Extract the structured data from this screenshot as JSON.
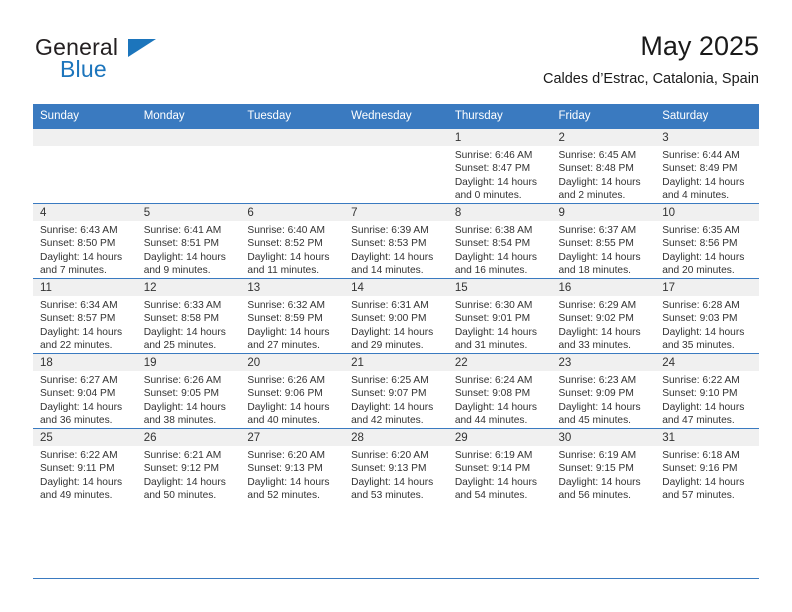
{
  "brand": {
    "name_top": "General",
    "name_bottom": "Blue",
    "accent_color": "#1c75bc"
  },
  "header": {
    "title": "May 2025",
    "subtitle": "Caldes d’Estrac, Catalonia, Spain"
  },
  "theme": {
    "header_bg": "#3a7ac0",
    "daynum_bg": "#f0f0f0",
    "grid_line": "#3a7ac0",
    "text": "#333333"
  },
  "weekday_headers": [
    "Sunday",
    "Monday",
    "Tuesday",
    "Wednesday",
    "Thursday",
    "Friday",
    "Saturday"
  ],
  "weeks": [
    [
      {
        "day": "",
        "empty": true
      },
      {
        "day": "",
        "empty": true
      },
      {
        "day": "",
        "empty": true
      },
      {
        "day": "",
        "empty": true
      },
      {
        "day": "1",
        "sunrise": "Sunrise: 6:46 AM",
        "sunset": "Sunset: 8:47 PM",
        "daylight_line1": "Daylight: 14 hours",
        "daylight_line2": "and 0 minutes."
      },
      {
        "day": "2",
        "sunrise": "Sunrise: 6:45 AM",
        "sunset": "Sunset: 8:48 PM",
        "daylight_line1": "Daylight: 14 hours",
        "daylight_line2": "and 2 minutes."
      },
      {
        "day": "3",
        "sunrise": "Sunrise: 6:44 AM",
        "sunset": "Sunset: 8:49 PM",
        "daylight_line1": "Daylight: 14 hours",
        "daylight_line2": "and 4 minutes."
      }
    ],
    [
      {
        "day": "4",
        "sunrise": "Sunrise: 6:43 AM",
        "sunset": "Sunset: 8:50 PM",
        "daylight_line1": "Daylight: 14 hours",
        "daylight_line2": "and 7 minutes."
      },
      {
        "day": "5",
        "sunrise": "Sunrise: 6:41 AM",
        "sunset": "Sunset: 8:51 PM",
        "daylight_line1": "Daylight: 14 hours",
        "daylight_line2": "and 9 minutes."
      },
      {
        "day": "6",
        "sunrise": "Sunrise: 6:40 AM",
        "sunset": "Sunset: 8:52 PM",
        "daylight_line1": "Daylight: 14 hours",
        "daylight_line2": "and 11 minutes."
      },
      {
        "day": "7",
        "sunrise": "Sunrise: 6:39 AM",
        "sunset": "Sunset: 8:53 PM",
        "daylight_line1": "Daylight: 14 hours",
        "daylight_line2": "and 14 minutes."
      },
      {
        "day": "8",
        "sunrise": "Sunrise: 6:38 AM",
        "sunset": "Sunset: 8:54 PM",
        "daylight_line1": "Daylight: 14 hours",
        "daylight_line2": "and 16 minutes."
      },
      {
        "day": "9",
        "sunrise": "Sunrise: 6:37 AM",
        "sunset": "Sunset: 8:55 PM",
        "daylight_line1": "Daylight: 14 hours",
        "daylight_line2": "and 18 minutes."
      },
      {
        "day": "10",
        "sunrise": "Sunrise: 6:35 AM",
        "sunset": "Sunset: 8:56 PM",
        "daylight_line1": "Daylight: 14 hours",
        "daylight_line2": "and 20 minutes."
      }
    ],
    [
      {
        "day": "11",
        "sunrise": "Sunrise: 6:34 AM",
        "sunset": "Sunset: 8:57 PM",
        "daylight_line1": "Daylight: 14 hours",
        "daylight_line2": "and 22 minutes."
      },
      {
        "day": "12",
        "sunrise": "Sunrise: 6:33 AM",
        "sunset": "Sunset: 8:58 PM",
        "daylight_line1": "Daylight: 14 hours",
        "daylight_line2": "and 25 minutes."
      },
      {
        "day": "13",
        "sunrise": "Sunrise: 6:32 AM",
        "sunset": "Sunset: 8:59 PM",
        "daylight_line1": "Daylight: 14 hours",
        "daylight_line2": "and 27 minutes."
      },
      {
        "day": "14",
        "sunrise": "Sunrise: 6:31 AM",
        "sunset": "Sunset: 9:00 PM",
        "daylight_line1": "Daylight: 14 hours",
        "daylight_line2": "and 29 minutes."
      },
      {
        "day": "15",
        "sunrise": "Sunrise: 6:30 AM",
        "sunset": "Sunset: 9:01 PM",
        "daylight_line1": "Daylight: 14 hours",
        "daylight_line2": "and 31 minutes."
      },
      {
        "day": "16",
        "sunrise": "Sunrise: 6:29 AM",
        "sunset": "Sunset: 9:02 PM",
        "daylight_line1": "Daylight: 14 hours",
        "daylight_line2": "and 33 minutes."
      },
      {
        "day": "17",
        "sunrise": "Sunrise: 6:28 AM",
        "sunset": "Sunset: 9:03 PM",
        "daylight_line1": "Daylight: 14 hours",
        "daylight_line2": "and 35 minutes."
      }
    ],
    [
      {
        "day": "18",
        "sunrise": "Sunrise: 6:27 AM",
        "sunset": "Sunset: 9:04 PM",
        "daylight_line1": "Daylight: 14 hours",
        "daylight_line2": "and 36 minutes."
      },
      {
        "day": "19",
        "sunrise": "Sunrise: 6:26 AM",
        "sunset": "Sunset: 9:05 PM",
        "daylight_line1": "Daylight: 14 hours",
        "daylight_line2": "and 38 minutes."
      },
      {
        "day": "20",
        "sunrise": "Sunrise: 6:26 AM",
        "sunset": "Sunset: 9:06 PM",
        "daylight_line1": "Daylight: 14 hours",
        "daylight_line2": "and 40 minutes."
      },
      {
        "day": "21",
        "sunrise": "Sunrise: 6:25 AM",
        "sunset": "Sunset: 9:07 PM",
        "daylight_line1": "Daylight: 14 hours",
        "daylight_line2": "and 42 minutes."
      },
      {
        "day": "22",
        "sunrise": "Sunrise: 6:24 AM",
        "sunset": "Sunset: 9:08 PM",
        "daylight_line1": "Daylight: 14 hours",
        "daylight_line2": "and 44 minutes."
      },
      {
        "day": "23",
        "sunrise": "Sunrise: 6:23 AM",
        "sunset": "Sunset: 9:09 PM",
        "daylight_line1": "Daylight: 14 hours",
        "daylight_line2": "and 45 minutes."
      },
      {
        "day": "24",
        "sunrise": "Sunrise: 6:22 AM",
        "sunset": "Sunset: 9:10 PM",
        "daylight_line1": "Daylight: 14 hours",
        "daylight_line2": "and 47 minutes."
      }
    ],
    [
      {
        "day": "25",
        "sunrise": "Sunrise: 6:22 AM",
        "sunset": "Sunset: 9:11 PM",
        "daylight_line1": "Daylight: 14 hours",
        "daylight_line2": "and 49 minutes."
      },
      {
        "day": "26",
        "sunrise": "Sunrise: 6:21 AM",
        "sunset": "Sunset: 9:12 PM",
        "daylight_line1": "Daylight: 14 hours",
        "daylight_line2": "and 50 minutes."
      },
      {
        "day": "27",
        "sunrise": "Sunrise: 6:20 AM",
        "sunset": "Sunset: 9:13 PM",
        "daylight_line1": "Daylight: 14 hours",
        "daylight_line2": "and 52 minutes."
      },
      {
        "day": "28",
        "sunrise": "Sunrise: 6:20 AM",
        "sunset": "Sunset: 9:13 PM",
        "daylight_line1": "Daylight: 14 hours",
        "daylight_line2": "and 53 minutes."
      },
      {
        "day": "29",
        "sunrise": "Sunrise: 6:19 AM",
        "sunset": "Sunset: 9:14 PM",
        "daylight_line1": "Daylight: 14 hours",
        "daylight_line2": "and 54 minutes."
      },
      {
        "day": "30",
        "sunrise": "Sunrise: 6:19 AM",
        "sunset": "Sunset: 9:15 PM",
        "daylight_line1": "Daylight: 14 hours",
        "daylight_line2": "and 56 minutes."
      },
      {
        "day": "31",
        "sunrise": "Sunrise: 6:18 AM",
        "sunset": "Sunset: 9:16 PM",
        "daylight_line1": "Daylight: 14 hours",
        "daylight_line2": "and 57 minutes."
      }
    ]
  ]
}
